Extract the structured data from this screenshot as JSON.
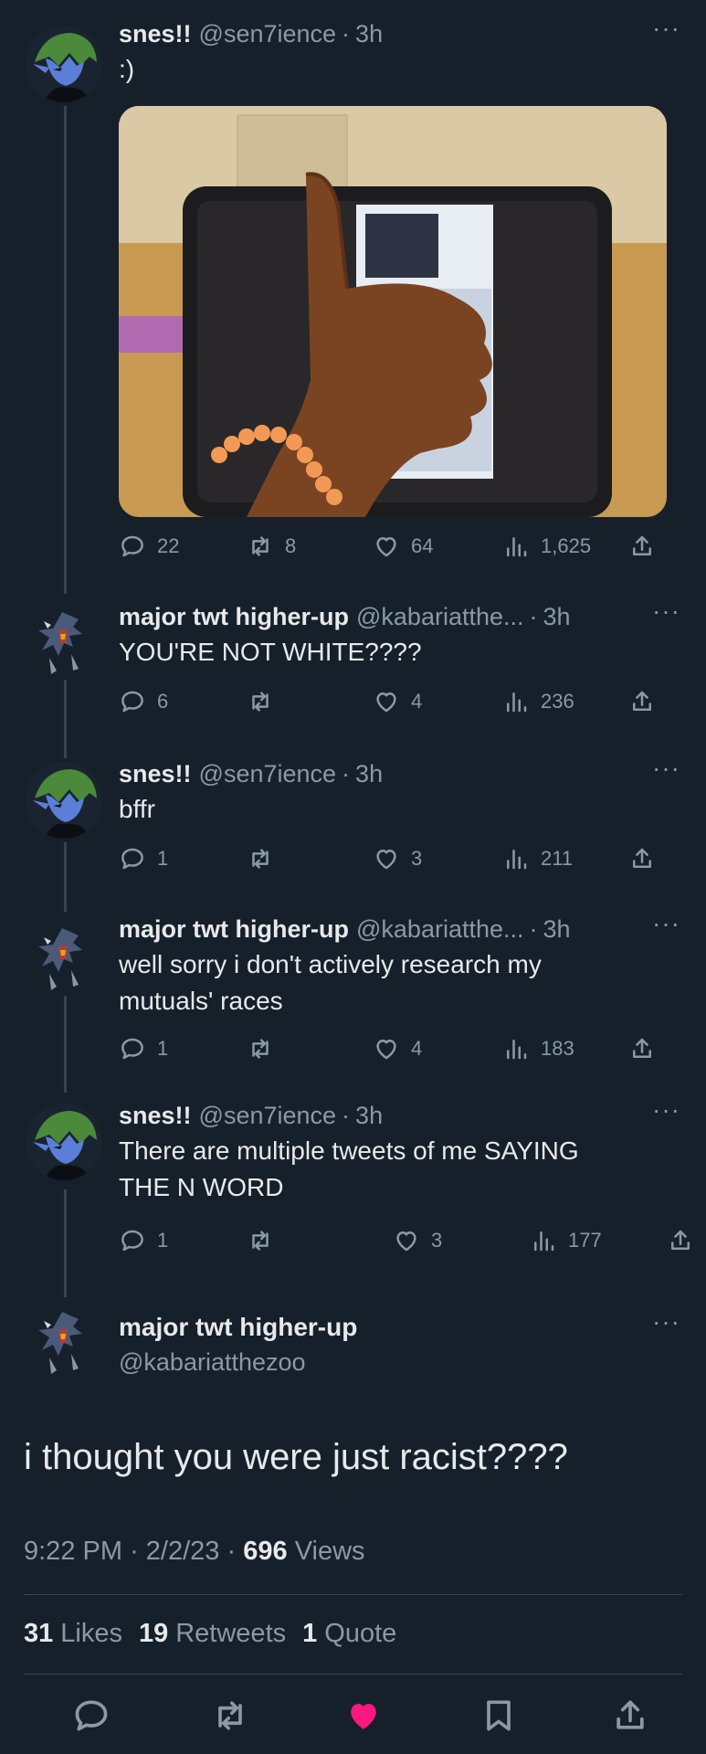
{
  "thread": [
    {
      "name": "snes!!",
      "handle": "@sen7ience",
      "time": "3h",
      "text": ":)",
      "has_media": true,
      "avatar_icon": "green-haired-elf-avatar",
      "replies": "22",
      "retweets": "8",
      "likes": "64",
      "views": "1,625"
    },
    {
      "name": "major twt higher-up",
      "handle": "@kabariatthe...",
      "time": "3h",
      "text": "YOU'RE NOT WHITE????",
      "avatar_icon": "garchomp-avatar",
      "replies": "6",
      "retweets": "",
      "likes": "4",
      "views": "236"
    },
    {
      "name": "snes!!",
      "handle": "@sen7ience",
      "time": "3h",
      "text": "bffr",
      "avatar_icon": "green-haired-elf-avatar",
      "replies": "1",
      "retweets": "",
      "likes": "3",
      "views": "211"
    },
    {
      "name": "major twt higher-up",
      "handle": "@kabariatthe...",
      "time": "3h",
      "text": "well sorry i don't actively research my\nmutuals' races",
      "avatar_icon": "garchomp-avatar",
      "replies": "1",
      "retweets": "",
      "likes": "4",
      "views": "183"
    },
    {
      "name": "snes!!",
      "handle": "@sen7ience",
      "time": "3h",
      "text": "There are multiple tweets of me SAYING\nTHE N WORD",
      "avatar_icon": "green-haired-elf-avatar",
      "replies": "1",
      "retweets": "",
      "likes": "3",
      "views": "177"
    }
  ],
  "main_tweet": {
    "name": "major twt higher-up",
    "handle": "@kabariatthezoo",
    "text": "i thought you were just racist????",
    "time": "9:22 PM",
    "date": "2/2/23",
    "views_count": "696",
    "views_label": "Views",
    "likes_count": "31",
    "likes_label": "Likes",
    "retweets_count": "19",
    "retweets_label": "Retweets",
    "quotes_count": "1",
    "quotes_label": "Quote"
  },
  "more_glyph": "···",
  "dot": "·",
  "colors": {
    "background": "#15202b",
    "muted": "#8b98a5",
    "like_active": "#f91880",
    "divider": "#38444d"
  },
  "bottom_actions": [
    "reply-icon",
    "retweet-icon",
    "like-icon",
    "bookmark-icon",
    "share-icon"
  ]
}
